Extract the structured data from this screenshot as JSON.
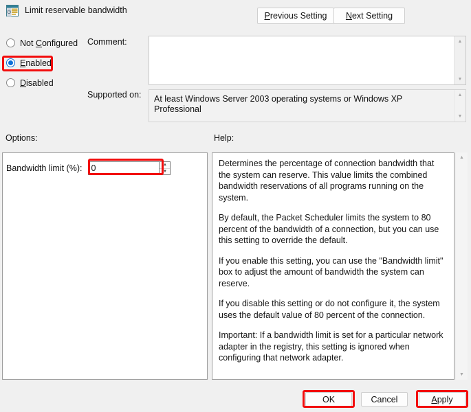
{
  "window": {
    "title": "Limit reservable bandwidth",
    "icon": "policy-window-icon"
  },
  "nav": {
    "previous_setting": {
      "prefix": "",
      "accel": "P",
      "rest": "revious Setting"
    },
    "next_setting": {
      "prefix": "",
      "accel": "N",
      "rest": "ext Setting"
    }
  },
  "state": {
    "options": [
      {
        "id": "not-configured",
        "pre": "Not ",
        "accel": "C",
        "post": "onfigured",
        "checked": false,
        "highlighted": false
      },
      {
        "id": "enabled",
        "pre": "",
        "accel": "E",
        "post": "nabled",
        "checked": true,
        "highlighted": true
      },
      {
        "id": "disabled",
        "pre": "",
        "accel": "D",
        "post": "isabled",
        "checked": false,
        "highlighted": false
      }
    ]
  },
  "fields": {
    "comment_label": "Comment:",
    "comment_value": "",
    "supported_label": "Supported on:",
    "supported_value": "At least Windows Server 2003 operating systems or Windows XP Professional"
  },
  "options_panel": {
    "header": "Options:",
    "bandwidth_label": "Bandwidth limit (%):",
    "bandwidth_value": "0"
  },
  "help_panel": {
    "header": "Help:",
    "paragraphs": [
      "Determines the percentage of connection bandwidth that the system can reserve. This value limits the combined bandwidth reservations of all programs running on the system.",
      "By default, the Packet Scheduler limits the system to 80 percent of the bandwidth of a connection, but you can use this setting to override the default.",
      "If you enable this setting, you can use the \"Bandwidth limit\" box to adjust the amount of bandwidth the system can reserve.",
      "If you disable this setting or do not configure it, the system uses the default value of 80 percent of the connection.",
      "Important: If a bandwidth limit is set for a particular network adapter in the registry, this setting is ignored when configuring that network adapter."
    ]
  },
  "footer": {
    "ok": "OK",
    "cancel": "Cancel",
    "apply": {
      "accel": "A",
      "rest": "pply"
    }
  },
  "icons": {
    "scroll_up": "▲",
    "scroll_down": "▼",
    "spin_up": "▲",
    "spin_down": "▼"
  },
  "colors": {
    "highlight": "#f20d0d",
    "radio_accent": "#0a6fd8",
    "window_bg": "#f0f0f0"
  }
}
